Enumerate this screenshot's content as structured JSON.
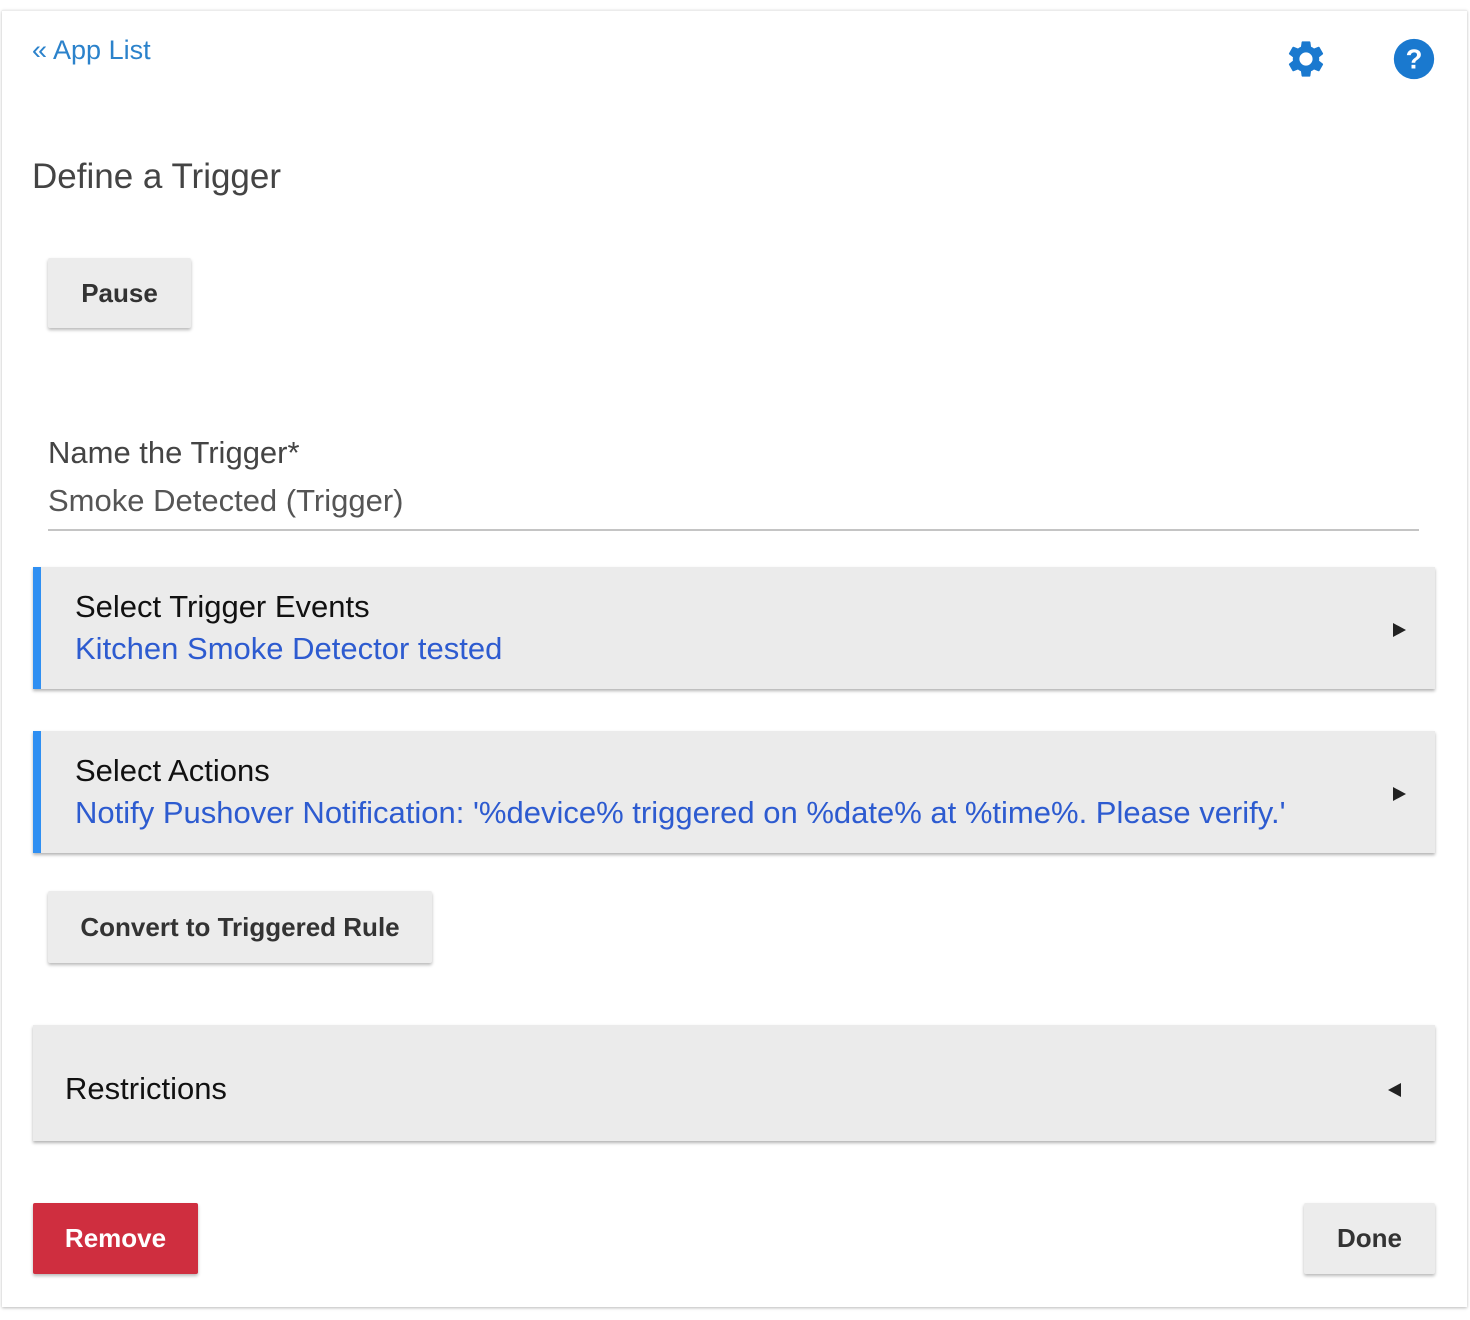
{
  "header": {
    "back_link": "« App List",
    "icons": [
      "gear-icon",
      "help-icon"
    ]
  },
  "page": {
    "title": "Define a Trigger",
    "pause_button": "Pause"
  },
  "name_field": {
    "label": "Name the Trigger*",
    "value": "Smoke Detected (Trigger)"
  },
  "sections": {
    "trigger_events": {
      "title": "Select Trigger Events",
      "summary": "Kitchen Smoke Detector tested"
    },
    "actions": {
      "title": "Select Actions",
      "summary": "Notify Pushover Notification: '%device% triggered on %date% at %time%. Please verify.'"
    },
    "restrictions": {
      "title": "Restrictions"
    }
  },
  "buttons": {
    "convert": "Convert to Triggered Rule",
    "remove": "Remove",
    "done": "Done"
  },
  "colors": {
    "link": "#2b82cb",
    "accent": "#2f8ff2",
    "summary_text": "#2d5bd0",
    "remove": "#cf2e3f",
    "icon": "#1a79cf"
  }
}
